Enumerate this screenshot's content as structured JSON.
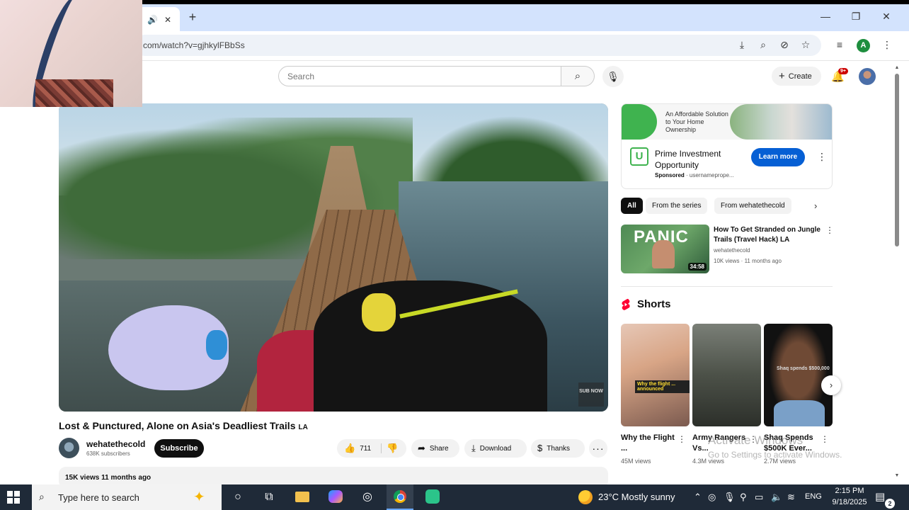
{
  "browser": {
    "url": "com/watch?v=gjhkylFBbSs",
    "new_tab": "+",
    "window_controls": {
      "minimize": "—",
      "restore": "❐",
      "close": "✕"
    },
    "tab_icons": {
      "audio": "🔊",
      "close": "✕"
    },
    "profile_initial": "A"
  },
  "youtube": {
    "search_placeholder": "Search",
    "create_label": "Create",
    "notifications_badge": "9+"
  },
  "video": {
    "title": "Lost & Punctured, Alone on Asia's Deadliest Trails",
    "title_badge": "LA",
    "overlay_logo": "SUB NOW",
    "channel_name": "wehatethecold",
    "subscribers": "638K subscribers",
    "subscribe_label": "Subscribe",
    "likes": "711",
    "share_label": "Share",
    "download_label": "Download",
    "thanks_label": "Thanks",
    "more_label": "···",
    "views_line": "15K views  11 months ago"
  },
  "ad": {
    "banner_text": "An Affordable Solution to Your Home Ownership",
    "logo_text": "U",
    "title": "Prime Investment Opportunity",
    "sponsored_label": "Sponsored",
    "advertiser": "usernameprope...",
    "cta": "Learn more"
  },
  "chips": [
    "All",
    "From the series",
    "From wehatethecold"
  ],
  "related": {
    "thumb_text": "PANIC",
    "duration": "34:58",
    "title": "How To Get Stranded on Jungle Trails (Travel Hack) LA",
    "channel": "wehatethecold",
    "meta": "10K views · 11 months ago"
  },
  "shorts": {
    "heading": "Shorts",
    "items": [
      {
        "title": "Why the Flight ...",
        "views": "45M views",
        "caption": "Why the flight ... announced"
      },
      {
        "title": "Army Rangers Vs...",
        "views": "4.3M views",
        "caption": ""
      },
      {
        "title": "Shaq Spends $500K Ever...",
        "views": "2.7M views",
        "caption": "Shaq spends $500,000"
      }
    ]
  },
  "watermark": {
    "line1": "Activate Windows",
    "line2": "Go to Settings to activate Windows."
  },
  "taskbar": {
    "search_placeholder": "Type here to search",
    "weather": "23°C  Mostly sunny",
    "language": "ENG",
    "time": "2:15 PM",
    "date": "9/18/2025",
    "notification_count": "2"
  },
  "colors": {
    "tabbar_bg": "#d3e3fd",
    "subscribe_bg": "#0f0f0f",
    "ad_cta": "#065fd4",
    "taskbar_bg": "#1f2a38",
    "shorts_red": "#ff0033"
  }
}
